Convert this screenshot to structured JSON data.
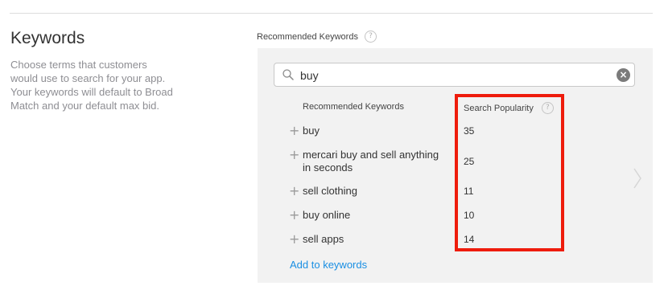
{
  "section": {
    "title": "Keywords",
    "description": "Choose terms that customers would use to search for your app. Your keywords will default to Broad Match and your default max bid."
  },
  "panel": {
    "label": "Recommended Keywords",
    "help_glyph": "?"
  },
  "search": {
    "value": "buy",
    "clear_glyph": "×"
  },
  "table": {
    "headers": {
      "keyword": "Recommended Keywords",
      "popularity": "Search Popularity"
    },
    "add_glyph": "+",
    "rows": [
      {
        "keyword": "buy",
        "popularity": "35"
      },
      {
        "keyword": "mercari buy and sell anything in seconds",
        "popularity": "25"
      },
      {
        "keyword": "sell clothing",
        "popularity": "11"
      },
      {
        "keyword": "buy online",
        "popularity": "10"
      },
      {
        "keyword": "sell apps",
        "popularity": "14"
      }
    ]
  },
  "actions": {
    "add_to_keywords": "Add to keywords"
  },
  "colors": {
    "link": "#1a8fe3",
    "highlight": "#ee1c0c",
    "panel_bg": "#f2f2f2"
  }
}
